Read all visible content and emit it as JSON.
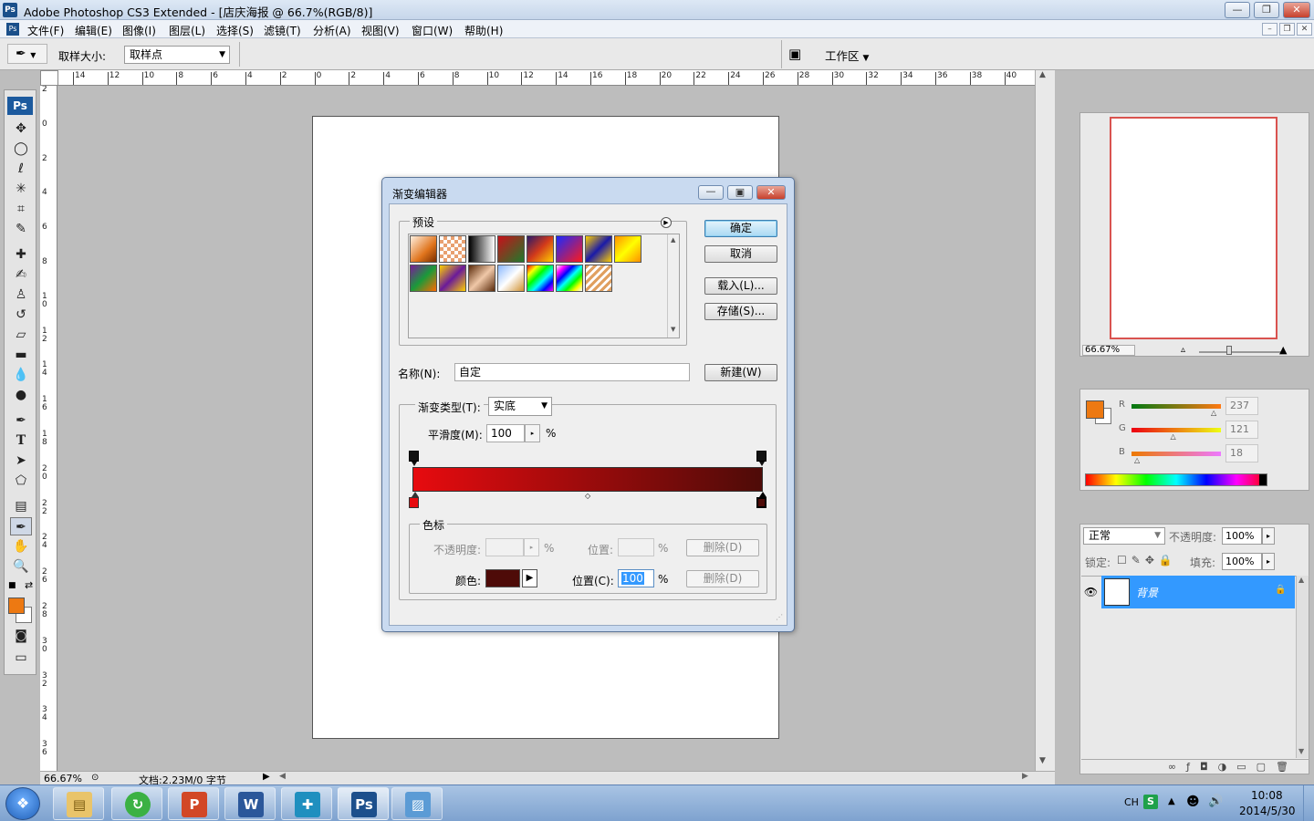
{
  "window": {
    "app_icon": "Ps",
    "title": "Adobe Photoshop CS3 Extended - [店庆海报 @ 66.7%(RGB/8)]",
    "controls": [
      "—",
      "❐",
      "✕"
    ]
  },
  "menubar": {
    "items": [
      "文件(F)",
      "编辑(E)",
      "图像(I)",
      "图层(L)",
      "选择(S)",
      "滤镜(T)",
      "分析(A)",
      "视图(V)",
      "窗口(W)",
      "帮助(H)"
    ]
  },
  "options_bar": {
    "sample_size_label": "取样大小:",
    "sample_size_value": "取样点",
    "workspace_label": "工作区"
  },
  "rulers": {
    "horizontal": [
      "14",
      "12",
      "10",
      "8",
      "6",
      "4",
      "2",
      "0",
      "2",
      "4",
      "6",
      "8",
      "10",
      "12",
      "14",
      "16",
      "18",
      "20",
      "22",
      "24",
      "26",
      "28",
      "30",
      "32",
      "34",
      "36",
      "38",
      "40"
    ],
    "vertical": [
      "2",
      "0",
      "2",
      "4",
      "6",
      "8",
      "1\n0",
      "1\n2",
      "1\n4",
      "1\n6",
      "1\n8",
      "2\n0",
      "2\n2",
      "2\n4",
      "2\n6",
      "2\n8",
      "3\n0",
      "3\n2",
      "3\n4",
      "3\n6"
    ]
  },
  "status_bar": {
    "zoom": "66.67%",
    "doc_info": "文档:2.23M/0 字节"
  },
  "navigator": {
    "zoom": "66.67%"
  },
  "color_panel": {
    "foreground": "#ed7912",
    "channels": [
      {
        "label": "R",
        "value": "237",
        "fraction": 0.929
      },
      {
        "label": "G",
        "value": "121",
        "fraction": 0.475
      },
      {
        "label": "B",
        "value": "18",
        "fraction": 0.071
      }
    ]
  },
  "layers_panel": {
    "blend_mode": "正常",
    "opacity_label": "不透明度:",
    "opacity_value": "100%",
    "lock_label": "锁定:",
    "fill_label": "填充:",
    "fill_value": "100%",
    "layer_name": "背景"
  },
  "gradient_editor": {
    "title": "渐变编辑器",
    "presets_label": "预设",
    "ok": "确定",
    "cancel": "取消",
    "load": "载入(L)...",
    "save": "存储(S)...",
    "name_label": "名称(N):",
    "name_value": "自定",
    "new_button": "新建(W)",
    "type_label": "渐变类型(T):",
    "type_value": "实底",
    "smooth_label": "平滑度(M):",
    "smooth_value": "100",
    "percent": "%",
    "stops_group": "色标",
    "opacity_label": "不透明度:",
    "position_label_disabled": "位置:",
    "delete": "删除(D)",
    "color_label": "颜色:",
    "color_value": "#4e0b08",
    "position_label": "位置(C):",
    "position_value": "100",
    "gradient_start": "#e70b0f",
    "gradient_end": "#4e0b08"
  },
  "taskbar": {
    "lang": "CH",
    "time": "10:08",
    "date": "2014/5/30"
  }
}
